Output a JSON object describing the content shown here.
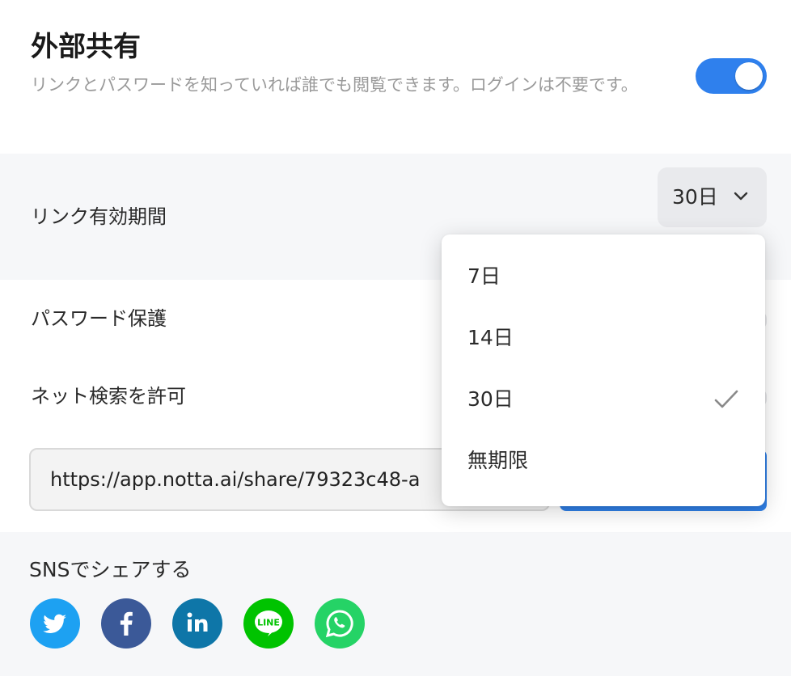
{
  "header": {
    "title": "外部共有",
    "description": "リンクとパスワードを知っていれば誰でも閲覧できます。ログインは不要です。",
    "share_toggle_on": true
  },
  "expiry": {
    "label": "リンク有効期間",
    "selected": "30日"
  },
  "password": {
    "label": "パスワード保護"
  },
  "net_search": {
    "label": "ネット検索を許可"
  },
  "link": {
    "url": "https://app.notta.ai/share/79323c48-a"
  },
  "sns": {
    "label": "SNSでシェアする",
    "items": [
      {
        "name": "twitter",
        "icon": "twitter-icon",
        "color": "#1da1f2"
      },
      {
        "name": "facebook",
        "icon": "facebook-icon",
        "color": "#3b5998"
      },
      {
        "name": "linkedin",
        "icon": "linkedin-icon",
        "color": "#0e76a8"
      },
      {
        "name": "line",
        "icon": "line-icon",
        "color": "#00c300"
      },
      {
        "name": "whatsapp",
        "icon": "whatsapp-icon",
        "color": "#25d366",
        "label": "LINE"
      }
    ]
  },
  "dropdown": {
    "options": [
      {
        "label": "7日"
      },
      {
        "label": "14日"
      },
      {
        "label": "30日",
        "selected": true
      },
      {
        "label": "無期限"
      }
    ]
  },
  "colors": {
    "accent": "#2f80ed",
    "section_bg": "#f6f7f9"
  }
}
